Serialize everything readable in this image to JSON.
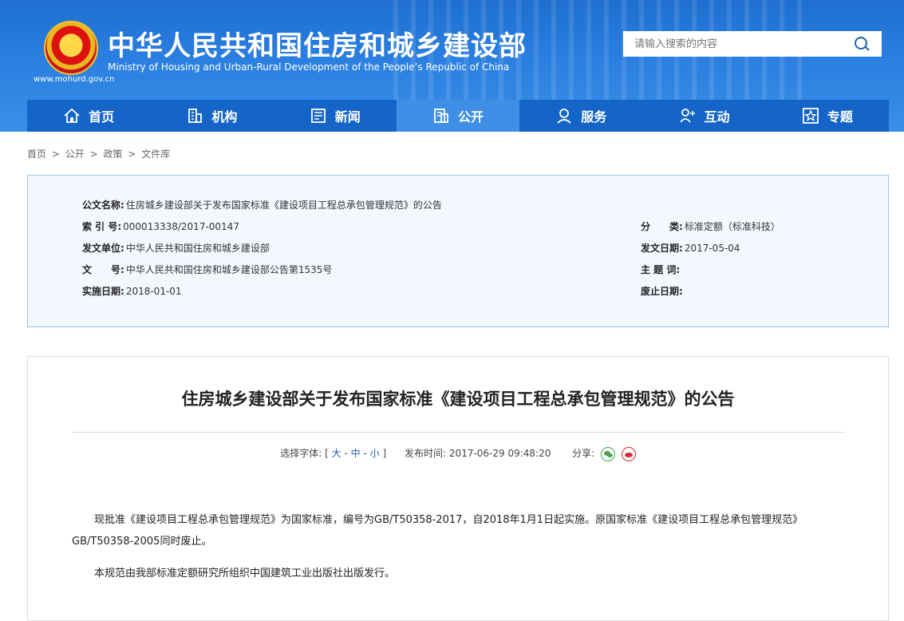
{
  "header": {
    "title": "中华人民共和国住房和城乡建设部",
    "subtitle": "Ministry of Housing and Urban-Rural Development of the People’s Republic of China",
    "url": "www.mohurd.gov.cn"
  },
  "search": {
    "placeholder": "请输入搜索的内容"
  },
  "nav": [
    {
      "label": "首页",
      "icon": "home-icon",
      "active": false
    },
    {
      "label": "机构",
      "icon": "building-icon",
      "active": false
    },
    {
      "label": "新闻",
      "icon": "news-icon",
      "active": false
    },
    {
      "label": "公开",
      "icon": "document-icon",
      "active": true
    },
    {
      "label": "服务",
      "icon": "service-icon",
      "active": false
    },
    {
      "label": "互动",
      "icon": "interaction-icon",
      "active": false
    },
    {
      "label": "专题",
      "icon": "star-icon",
      "active": false
    }
  ],
  "breadcrumb": [
    "首页",
    ">",
    "公开",
    ">",
    "政策",
    ">",
    "文件库"
  ],
  "meta": {
    "doc_name_label": "公文名称:",
    "doc_name": "住房城乡建设部关于发布国家标准《建设项目工程总承包管理规范》的公告",
    "index_label": "索 引 号:",
    "index": "000013338/2017-00147",
    "category_label": "分　　类:",
    "category": "标准定额（标准科技）",
    "issuer_label": "发文单位:",
    "issuer": "中华人民共和国住房和城乡建设部",
    "issue_date_label": "发文日期:",
    "issue_date": "2017-05-04",
    "doc_no_label": "文　　号:",
    "doc_no": "中华人民共和国住房和城乡建设部公告第1535号",
    "keywords_label": "主 题 词:",
    "keywords": "",
    "effective_label": "实施日期:",
    "effective": "2018-01-01",
    "expiry_label": "废止日期:",
    "expiry": ""
  },
  "article": {
    "title": "住房城乡建设部关于发布国家标准《建设项目工程总承包管理规范》的公告",
    "font_label": "选择字体:",
    "font_open": "[",
    "font_large": "大",
    "font_medium": "中",
    "font_small": "小",
    "font_close": "]",
    "sep": "-",
    "publish_label": "发布时间:",
    "publish_time": "2017-06-29 09:48:20",
    "share_label": "分享:",
    "para1": "现批准《建设项目工程总承包管理规范》为国家标准，编号为GB/T50358-2017，自2018年1月1日起实施。原国家标准《建设项目工程总承包管理规范》GB/T50358-2005同时废止。",
    "para2": "本规范由我部标准定额研究所组织中国建筑工业出版社出版发行。"
  }
}
